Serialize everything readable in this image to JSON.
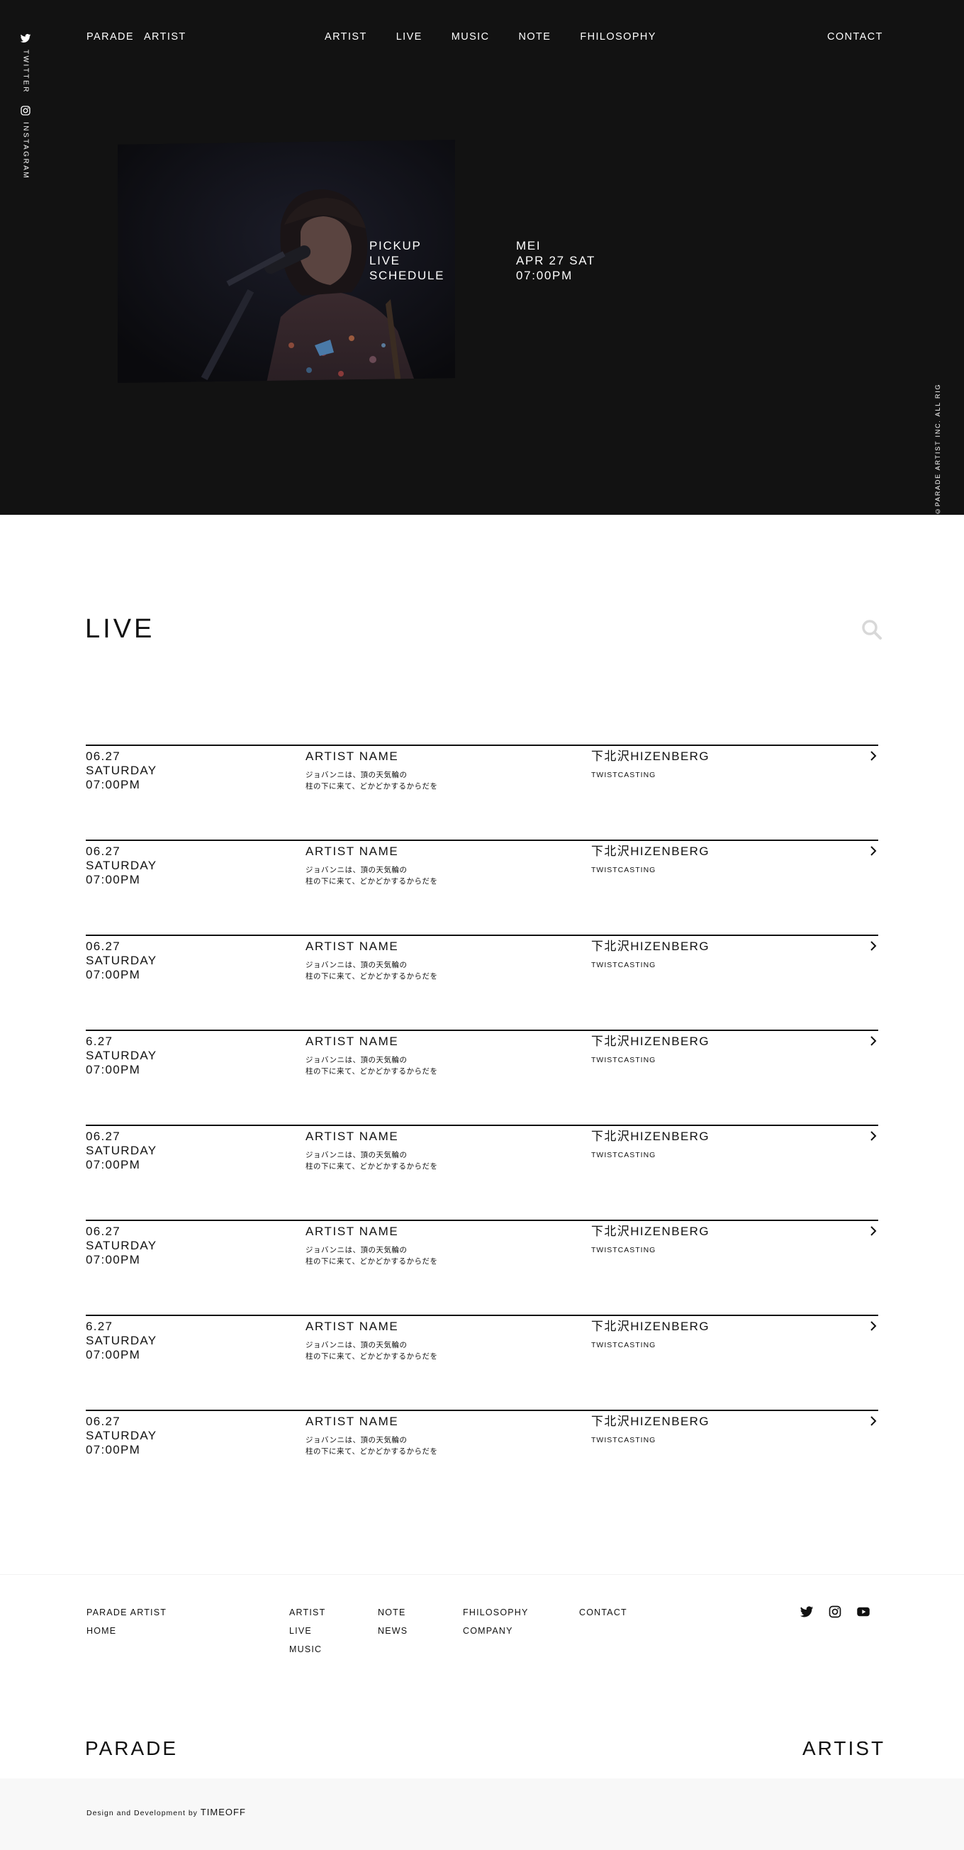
{
  "header": {
    "brand": [
      "PARADE",
      "ARTIST"
    ],
    "menu": [
      "ARTIST",
      "LIVE",
      "MUSIC",
      "NOTE",
      "FHILOSOPHY"
    ],
    "contact": "CONTACT"
  },
  "side_social": {
    "twitter": "TWITTER",
    "instagram": "INSTAGRAM"
  },
  "pickup": {
    "label": [
      "PICKUP",
      "LIVE",
      "SCHEDULE"
    ],
    "info": [
      "MEI",
      "APR 27 SAT",
      "07:00PM"
    ]
  },
  "copyright": "©PARADE ARTIST INC. ALL RIGHTS RESERVED.",
  "live": {
    "title": "LIVE",
    "rows": [
      {
        "date": "06.27",
        "day": "SATURDAY",
        "time": "07:00PM",
        "artist": "ARTIST NAME",
        "desc1": "ジョバンニは、頂の天気輪の",
        "desc2": "柱の下に来て、どかどかするからだを",
        "venue": "下北沢HIZENBERG",
        "sub": "TWISTCASTING"
      },
      {
        "date": "06.27",
        "day": "SATURDAY",
        "time": "07:00PM",
        "artist": "ARTIST NAME",
        "desc1": "ジョバンニは、頂の天気輪の",
        "desc2": "柱の下に来て、どかどかするからだを",
        "venue": "下北沢HIZENBERG",
        "sub": "TWISTCASTING"
      },
      {
        "date": "06.27",
        "day": "SATURDAY",
        "time": "07:00PM",
        "artist": "ARTIST NAME",
        "desc1": "ジョバンニは、頂の天気輪の",
        "desc2": "柱の下に来て、どかどかするからだを",
        "venue": "下北沢HIZENBERG",
        "sub": "TWISTCASTING"
      },
      {
        "date": "6.27",
        "day": "SATURDAY",
        "time": "07:00PM",
        "artist": "ARTIST NAME",
        "desc1": "ジョバンニは、頂の天気輪の",
        "desc2": "柱の下に来て、どかどかするからだを",
        "venue": "下北沢HIZENBERG",
        "sub": "TWISTCASTING"
      },
      {
        "date": "06.27",
        "day": "SATURDAY",
        "time": "07:00PM",
        "artist": "ARTIST NAME",
        "desc1": "ジョバンニは、頂の天気輪の",
        "desc2": "柱の下に来て、どかどかするからだを",
        "venue": "下北沢HIZENBERG",
        "sub": "TWISTCASTING"
      },
      {
        "date": "06.27",
        "day": "SATURDAY",
        "time": "07:00PM",
        "artist": "ARTIST NAME",
        "desc1": "ジョバンニは、頂の天気輪の",
        "desc2": "柱の下に来て、どかどかするからだを",
        "venue": "下北沢HIZENBERG",
        "sub": "TWISTCASTING"
      },
      {
        "date": "6.27",
        "day": "SATURDAY",
        "time": "07:00PM",
        "artist": "ARTIST NAME",
        "desc1": "ジョバンニは、頂の天気輪の",
        "desc2": "柱の下に来て、どかどかするからだを",
        "venue": "下北沢HIZENBERG",
        "sub": "TWISTCASTING"
      },
      {
        "date": "06.27",
        "day": "SATURDAY",
        "time": "07:00PM",
        "artist": "ARTIST NAME",
        "desc1": "ジョバンニは、頂の天気輪の",
        "desc2": "柱の下に来て、どかどかするからだを",
        "venue": "下北沢HIZENBERG",
        "sub": "TWISTCASTING"
      }
    ]
  },
  "footer": {
    "col1": [
      "PARADE ARTIST",
      "HOME"
    ],
    "col2": [
      "ARTIST",
      "LIVE",
      "MUSIC"
    ],
    "col3": [
      "NOTE",
      "NEWS"
    ],
    "col4": [
      "FHILOSOPHY",
      "COMPANY"
    ],
    "col5": [
      "CONTACT"
    ],
    "social_icons": [
      "twitter-icon",
      "instagram-icon",
      "youtube-icon"
    ],
    "logo_left": "PARADE",
    "logo_right": "ARTIST"
  },
  "credit": {
    "text": "Design and Development by",
    "brand": "TIMEOFF"
  }
}
